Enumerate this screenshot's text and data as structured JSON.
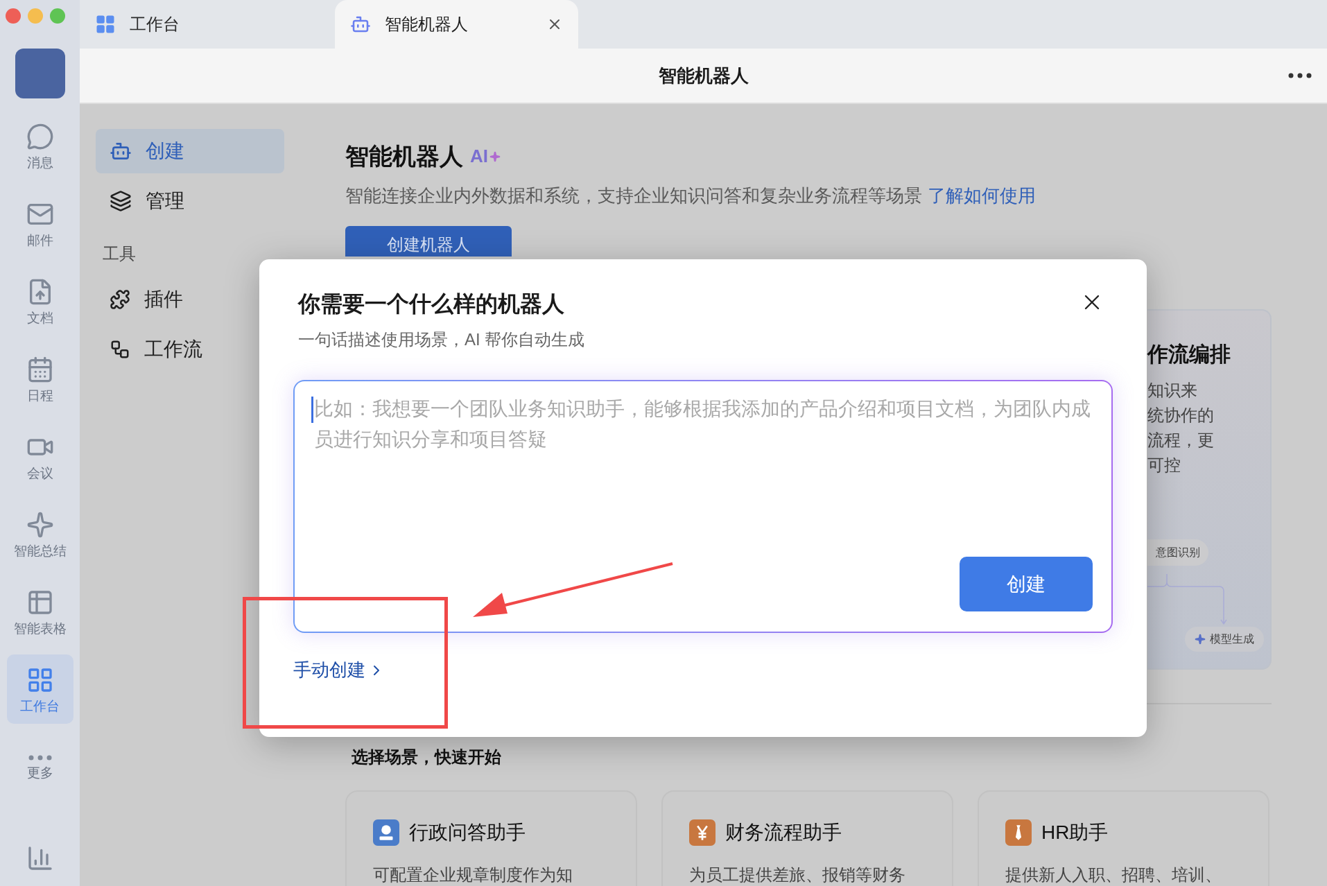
{
  "tabs": [
    {
      "label": "工作台",
      "selected": false
    },
    {
      "label": "智能机器人",
      "selected": true
    }
  ],
  "header": {
    "title": "智能机器人"
  },
  "sidebar": {
    "items": [
      {
        "label": "消息",
        "selected": false
      },
      {
        "label": "邮件",
        "selected": false
      },
      {
        "label": "文档",
        "selected": false
      },
      {
        "label": "日程",
        "selected": false
      },
      {
        "label": "会议",
        "selected": false
      },
      {
        "label": "智能总结",
        "selected": false
      },
      {
        "label": "智能表格",
        "selected": false
      },
      {
        "label": "工作台",
        "selected": true
      },
      {
        "label": "更多",
        "selected": false
      }
    ]
  },
  "nav": {
    "items": [
      {
        "label": "创建",
        "selected": true
      },
      {
        "label": "管理",
        "selected": false
      }
    ],
    "section": "工具",
    "tools": [
      {
        "label": "插件"
      },
      {
        "label": "工作流"
      }
    ]
  },
  "intro": {
    "title": "智能机器人",
    "badge": "AI",
    "description": "智能连接企业内外数据和系统，支持企业知识问答和复杂业务流程等场景",
    "link": "了解如何使用",
    "button": "创建机器人"
  },
  "feature_card": {
    "title": "作流编排",
    "lines": [
      "知识来",
      "统协作的",
      "流程，更",
      "可控"
    ],
    "nodes": [
      "意图识别",
      "模型生成"
    ]
  },
  "scenes": {
    "title": "选择场景，快速开始",
    "cards": [
      {
        "kind": "person",
        "color": "#4a7cc9",
        "title": "行政问答助手",
        "description": "可配置企业规章制度作为知"
      },
      {
        "kind": "yen",
        "color": "#c8773f",
        "title": "财务流程助手",
        "description": "为员工提供差旅、报销等财务"
      },
      {
        "kind": "tie",
        "color": "#c8773f",
        "title": "HR助手",
        "description": "提供新人入职、招聘、培训、"
      }
    ]
  },
  "modal": {
    "title": "你需要一个什么样的机器人",
    "subtitle": "一句话描述使用场景，AI 帮你自动生成",
    "placeholder": "比如：我想要一个团队业务知识助手，能够根据我添加的产品介绍和项目文档，为团队内成员进行知识分享和项目答疑",
    "submit": "创建",
    "manual_link": "手动创建"
  }
}
